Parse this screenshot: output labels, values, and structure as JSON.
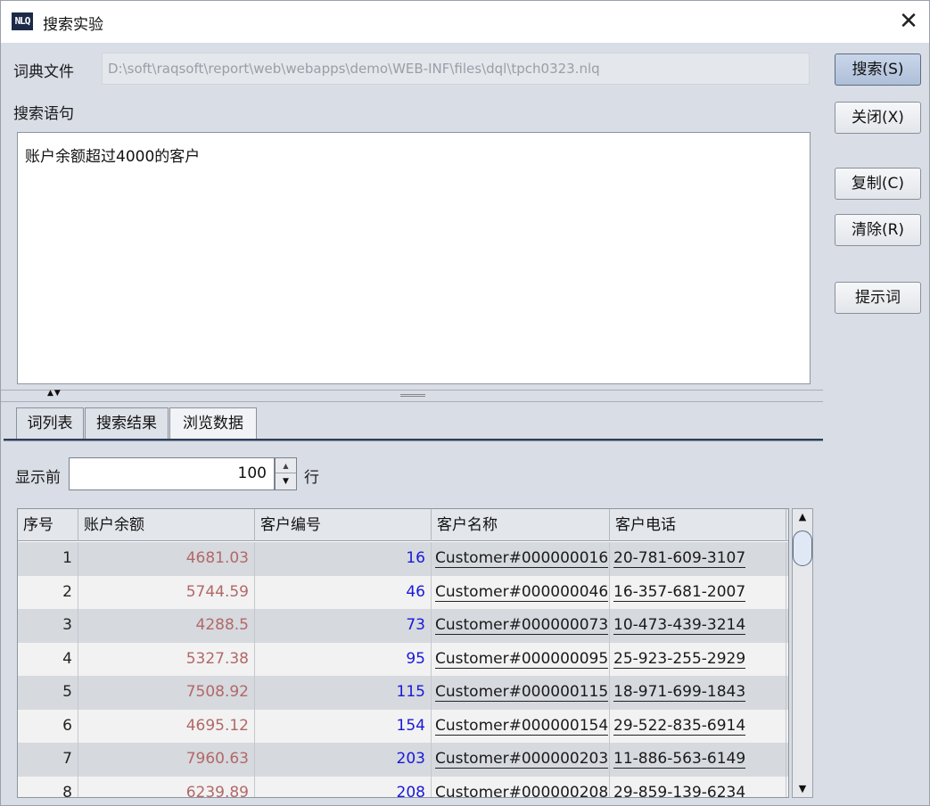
{
  "window": {
    "title": "搜索实验",
    "icon_text": "NLQ",
    "close_glyph": "✕"
  },
  "dict_file": {
    "label": "词典文件",
    "path": "D:\\soft\\raqsoft\\report\\web\\webapps\\demo\\WEB-INF\\files\\dql\\tpch0323.nlq"
  },
  "query": {
    "label": "搜索语句",
    "text": "账户余额超过4000的客户"
  },
  "buttons": {
    "search": "搜索(S)",
    "close": "关闭(X)",
    "copy": "复制(C)",
    "clear": "清除(R)",
    "hint": "提示词"
  },
  "splitter": {
    "arrows": "▲▼"
  },
  "tabs": [
    {
      "label": "词列表"
    },
    {
      "label": "搜索结果"
    },
    {
      "label": "浏览数据",
      "active": true
    }
  ],
  "display": {
    "prefix": "显示前",
    "count": "100",
    "suffix": "行"
  },
  "table": {
    "columns": [
      "序号",
      "账户余额",
      "客户编号",
      "客户名称",
      "客户电话"
    ],
    "rows": [
      [
        "1",
        "4681.03",
        "16",
        "Customer#000000016",
        "20-781-609-3107"
      ],
      [
        "2",
        "5744.59",
        "46",
        "Customer#000000046",
        "16-357-681-2007"
      ],
      [
        "3",
        "4288.5",
        "73",
        "Customer#000000073",
        "10-473-439-3214"
      ],
      [
        "4",
        "5327.38",
        "95",
        "Customer#000000095",
        "25-923-255-2929"
      ],
      [
        "5",
        "7508.92",
        "115",
        "Customer#000000115",
        "18-971-699-1843"
      ],
      [
        "6",
        "4695.12",
        "154",
        "Customer#000000154",
        "29-522-835-6914"
      ],
      [
        "7",
        "7960.63",
        "203",
        "Customer#000000203",
        "11-886-563-6149"
      ],
      [
        "8",
        "6239.89",
        "208",
        "Customer#000000208",
        "29-859-139-6234"
      ]
    ]
  },
  "colors": {
    "balance_text": "#b26868",
    "key_text": "#1919d9",
    "row_odd": "#d6d9de",
    "row_even": "#f2f2f2"
  }
}
